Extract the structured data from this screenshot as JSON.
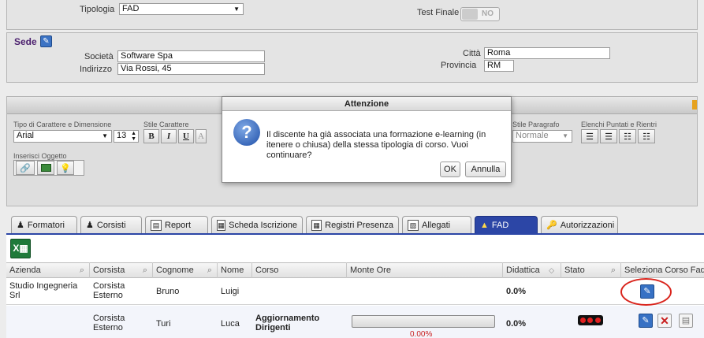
{
  "top": {
    "tipologia_label": "Tipologia",
    "tipologia_value": "FAD",
    "test_finale_label": "Test Finale",
    "test_finale_toggle": "NO"
  },
  "sede": {
    "title": "Sede",
    "societa_label": "Società",
    "societa_value": "Software Spa",
    "indirizzo_label": "Indirizzo",
    "indirizzo_value": "Via Rossi, 45",
    "citta_label": "Città",
    "citta_value": "Roma",
    "provincia_label": "Provincia",
    "provincia_value": "RM"
  },
  "editor": {
    "font_group_label": "Tipo di Carattere e Dimensione",
    "font_value": "Arial",
    "size_value": "13",
    "style_group_label": "Stile Carattere",
    "bold": "B",
    "italic": "I",
    "underline": "U",
    "paragraph_label": "Stile Paragrafo",
    "paragraph_value": "Normale",
    "list_label": "Elenchi Puntati e Rientri",
    "insert_label": "Inserisci Oggetto"
  },
  "dialog": {
    "title": "Attenzione",
    "message": "Il discente ha già associata una formazione e-learning (in itenere o chiusa) della stessa tipologia di corso. Vuoi continuare?",
    "ok_label": "OK",
    "cancel_label": "Annulla"
  },
  "tabs": [
    {
      "label": "Formatori",
      "icon": "user-icon"
    },
    {
      "label": "Corsisti",
      "icon": "users-icon"
    },
    {
      "label": "Report",
      "icon": "report-icon"
    },
    {
      "label": "Scheda Iscrizione",
      "icon": "form-icon"
    },
    {
      "label": "Registri Presenza",
      "icon": "calendar-icon"
    },
    {
      "label": "Allegati",
      "icon": "attachment-icon"
    },
    {
      "label": "FAD",
      "icon": "network-icon"
    },
    {
      "label": "Autorizzazioni",
      "icon": "key-icon"
    }
  ],
  "table": {
    "headers": [
      "Azienda",
      "Corsista",
      "Cognome",
      "Nome",
      "Corso",
      "Monte Ore",
      "Didattica",
      "Stato",
      "Seleziona Corso Fad"
    ],
    "rows": [
      {
        "azienda": "Studio Ingegneria Srl",
        "corsista": "Corsista Esterno",
        "cognome": "Bruno",
        "nome": "Luigi",
        "corso": "",
        "monte_ore": "",
        "didattica": "0.0%"
      },
      {
        "azienda": "",
        "corsista": "Corsista Esterno",
        "cognome": "Turi",
        "nome": "Luca",
        "corso": "Aggiornamento Dirigenti",
        "monte_ore": "0.00%",
        "didattica": "0.0%"
      }
    ]
  },
  "colors": {
    "accent": "#2c46a6",
    "highlight_circle": "#d9241c",
    "sede_title": "#4b1f6e"
  }
}
